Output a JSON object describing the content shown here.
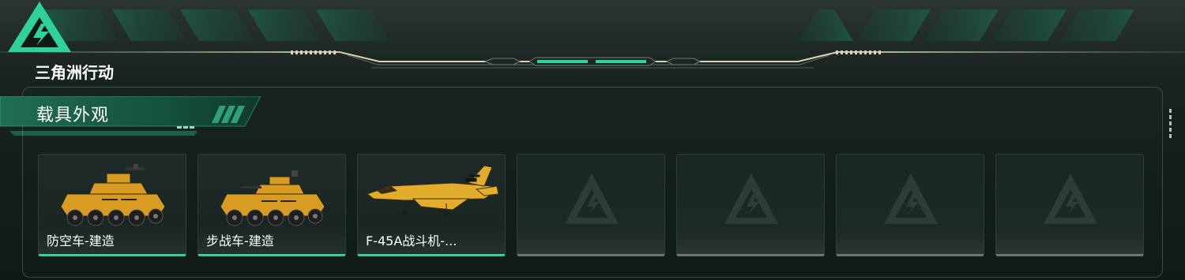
{
  "header": {
    "logo_text": "三角洲行动"
  },
  "section": {
    "title": "载具外观"
  },
  "cards": [
    {
      "label": "防空车-建造",
      "icon": "anti-air-vehicle",
      "state": "unlocked"
    },
    {
      "label": "步战车-建造",
      "icon": "infantry-fighting-vehicle",
      "state": "unlocked"
    },
    {
      "label": "F-45A战斗机-...",
      "icon": "fighter-jet",
      "state": "unlocked"
    },
    {
      "label": "",
      "icon": "delta-logo-placeholder",
      "state": "empty"
    },
    {
      "label": "",
      "icon": "delta-logo-placeholder",
      "state": "empty"
    },
    {
      "label": "",
      "icon": "delta-logo-placeholder",
      "state": "empty"
    },
    {
      "label": "",
      "icon": "delta-logo-placeholder",
      "state": "empty"
    }
  ],
  "colors": {
    "accent": "#2fd39a",
    "vehicle_yellow": "#e0a52a",
    "empty_underline": "#6c7572"
  }
}
